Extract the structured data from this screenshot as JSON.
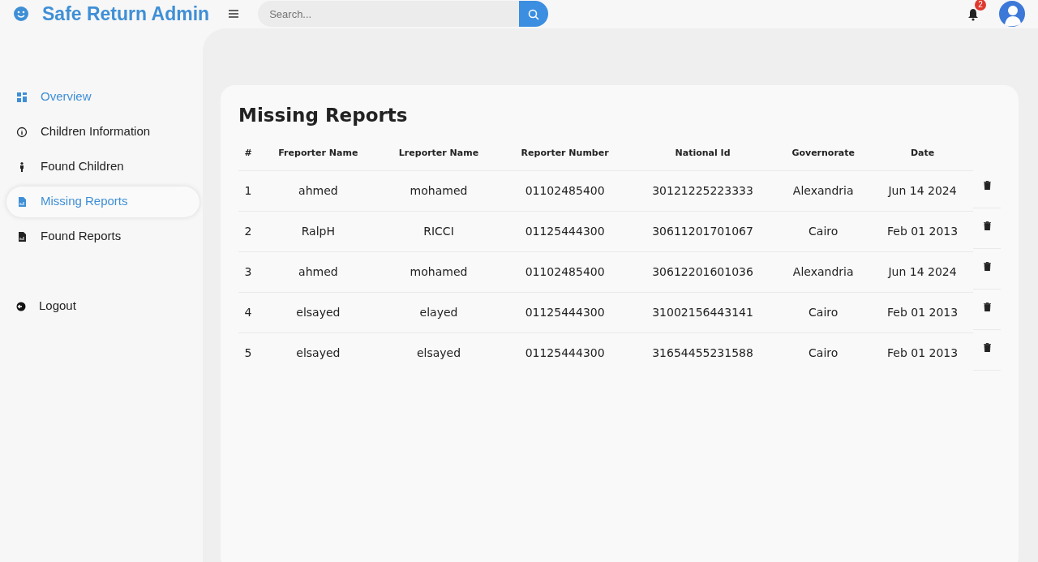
{
  "brand": {
    "title": "Safe Return Admin"
  },
  "search": {
    "placeholder": "Search..."
  },
  "notifications": {
    "count": "2"
  },
  "sidebar": {
    "items": [
      {
        "label": "Overview",
        "kind": "grid",
        "selected": false,
        "hovered": true
      },
      {
        "label": "Children Information",
        "kind": "info",
        "selected": false,
        "hovered": false
      },
      {
        "label": "Found Children",
        "kind": "person",
        "selected": false,
        "hovered": false
      },
      {
        "label": "Missing Reports",
        "kind": "file",
        "selected": true,
        "hovered": false
      },
      {
        "label": "Found Reports",
        "kind": "file",
        "selected": false,
        "hovered": false
      }
    ],
    "logout": "Logout"
  },
  "page": {
    "title": "Missing Reports"
  },
  "table": {
    "columns": [
      "#",
      "Freporter Name",
      "Lreporter Name",
      "Reporter Number",
      "National Id",
      "Governorate",
      "Date"
    ],
    "rows": [
      [
        "1",
        "ahmed",
        "mohamed",
        "01102485400",
        "30121225223333",
        "Alexandria",
        "Jun 14 2024"
      ],
      [
        "2",
        "RalpH",
        "RICCI",
        "01125444300",
        "30611201701067",
        "Cairo",
        "Feb 01 2013"
      ],
      [
        "3",
        "ahmed",
        "mohamed",
        "01102485400",
        "30612201601036",
        "Alexandria",
        "Jun 14 2024"
      ],
      [
        "4",
        "elsayed",
        "elayed",
        "01125444300",
        "31002156443141",
        "Cairo",
        "Feb 01 2013"
      ],
      [
        "5",
        "elsayed",
        "elsayed",
        "01125444300",
        "31654455231588",
        "Cairo",
        "Feb 01 2013"
      ]
    ]
  }
}
